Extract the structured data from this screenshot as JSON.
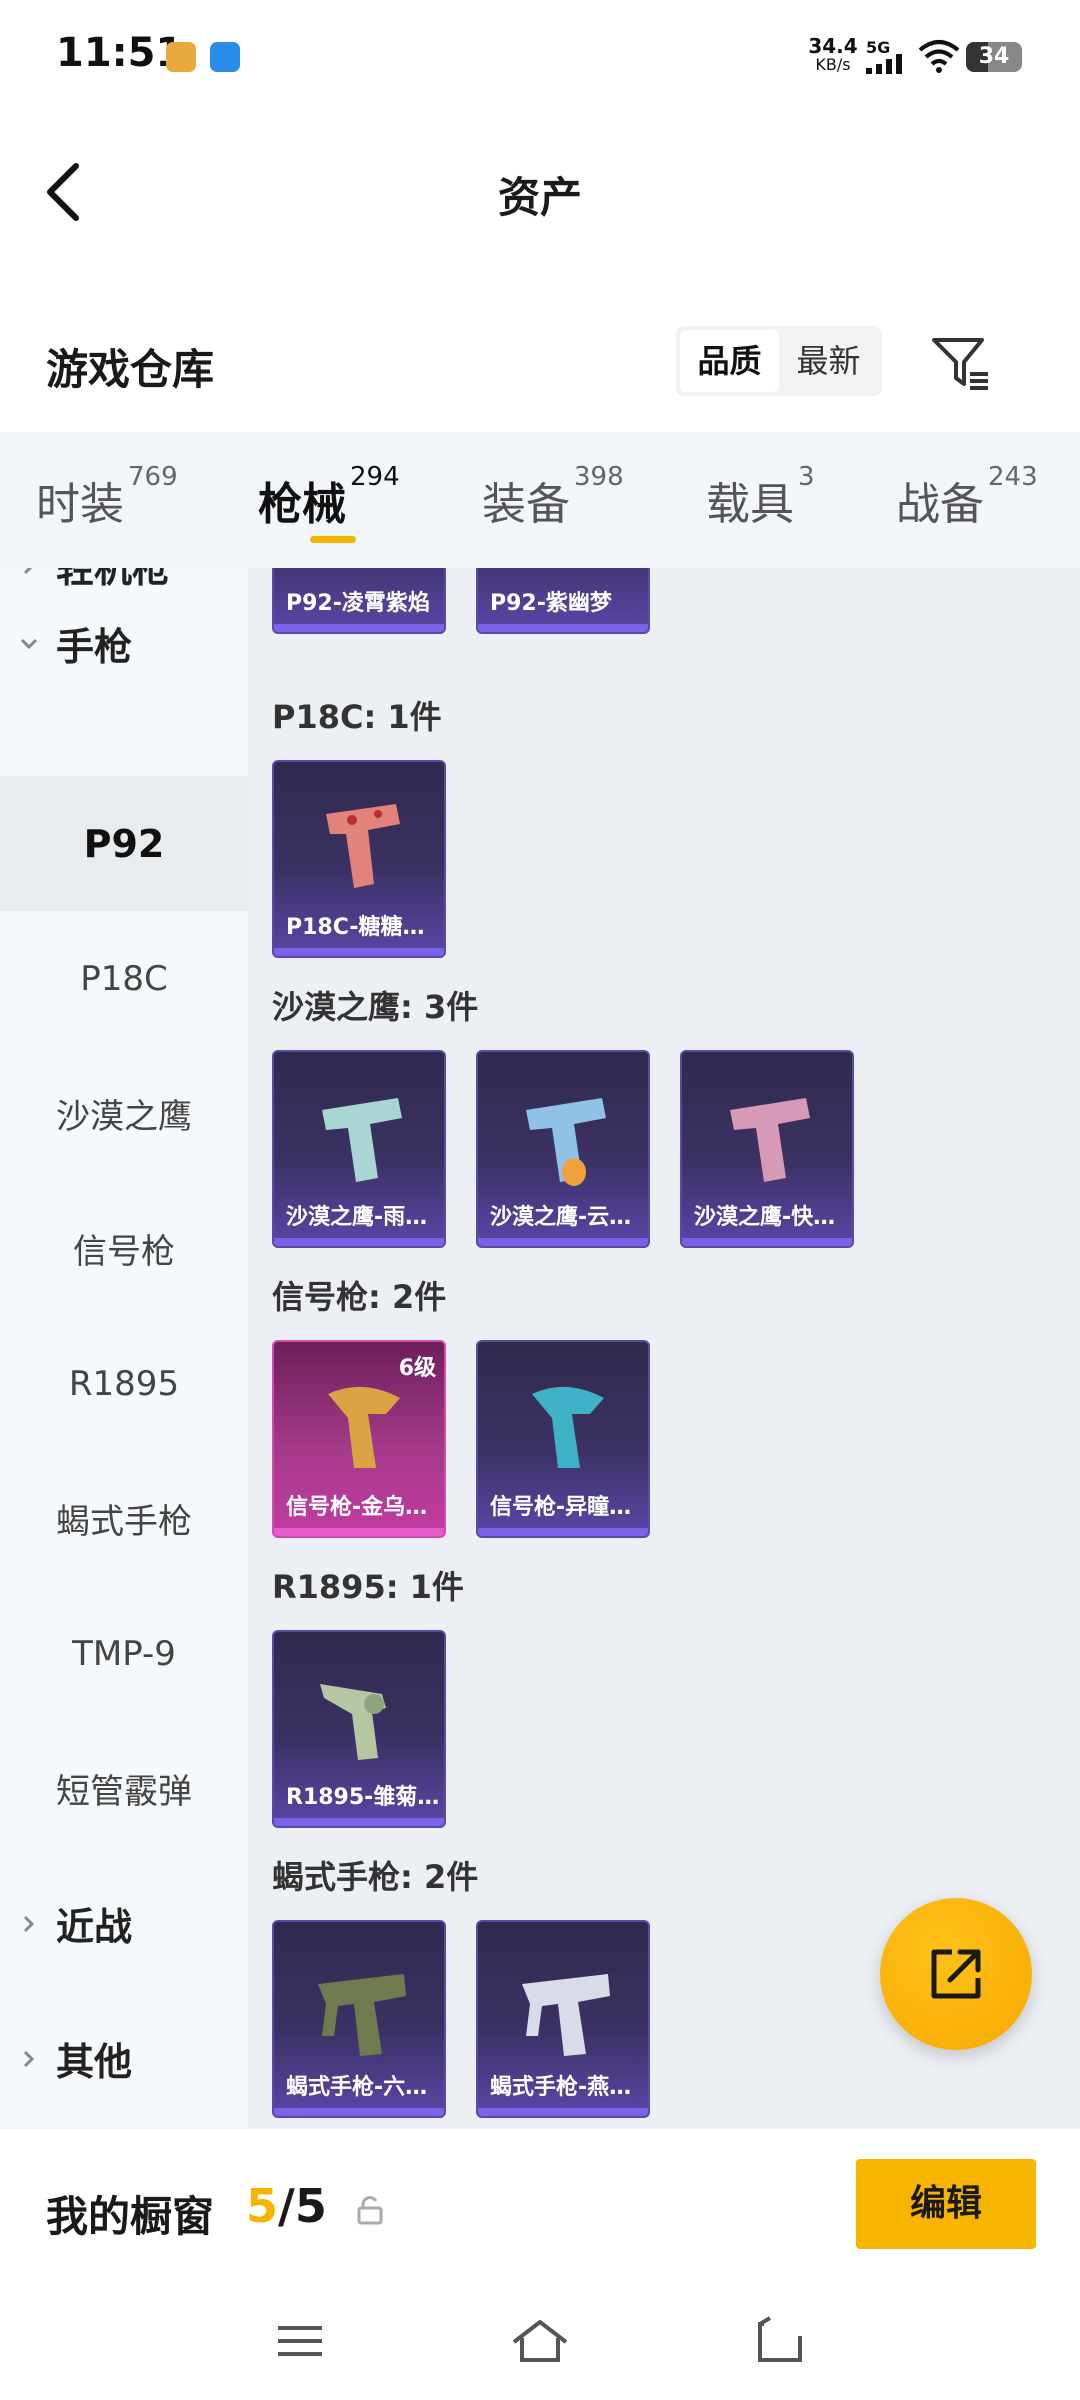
{
  "status_bar": {
    "time": "11:51",
    "net_speed_value": "34.4",
    "net_speed_unit": "KB/s",
    "network": "5G",
    "battery": "34"
  },
  "header": {
    "title": "资产"
  },
  "section": {
    "title": "游戏仓库",
    "sort_options": [
      "品质",
      "最新"
    ],
    "sort_selected": "品质"
  },
  "tabs": [
    {
      "label": "时装",
      "count": "769"
    },
    {
      "label": "枪械",
      "count": "294"
    },
    {
      "label": "装备",
      "count": "398"
    },
    {
      "label": "载具",
      "count": "3"
    },
    {
      "label": "战备",
      "count": "243"
    }
  ],
  "active_tab": "枪械",
  "left_nav": {
    "partial_top": "轻机枪",
    "group_pistol": "手枪",
    "items": [
      "P92",
      "P18C",
      "沙漠之鹰",
      "信号枪",
      "R1895",
      "蝎式手枪",
      "TMP-9",
      "短管霰弹"
    ],
    "active_item": "P92",
    "group_melee": "近战",
    "group_other": "其他"
  },
  "main": {
    "p92_cards": [
      "P92-凌霄紫焰",
      "P92-紫幽梦"
    ],
    "groups": [
      {
        "label": "P18C: 1件",
        "items": [
          "P18C-糖糖…"
        ]
      },
      {
        "label": "沙漠之鹰: 3件",
        "items": [
          "沙漠之鹰-雨…",
          "沙漠之鹰-云…",
          "沙漠之鹰-快…"
        ]
      },
      {
        "label": "信号枪: 2件",
        "items": [
          "信号枪-金乌…",
          "信号枪-异瞳…"
        ],
        "level_badge": "6级"
      },
      {
        "label": "R1895: 1件",
        "items": [
          "R1895-雏菊…"
        ]
      },
      {
        "label": "蝎式手枪: 2件",
        "items": [
          "蝎式手枪-六…",
          "蝎式手枪-燕…"
        ]
      }
    ]
  },
  "bottom_bar": {
    "title": "我的橱窗",
    "count_used": "5",
    "count_sep": "/",
    "count_total": "5",
    "edit_label": "编辑"
  },
  "colors": {
    "accent": "#f4b400",
    "card_purple": "#3b3163",
    "card_gold": "#a43a8a"
  }
}
